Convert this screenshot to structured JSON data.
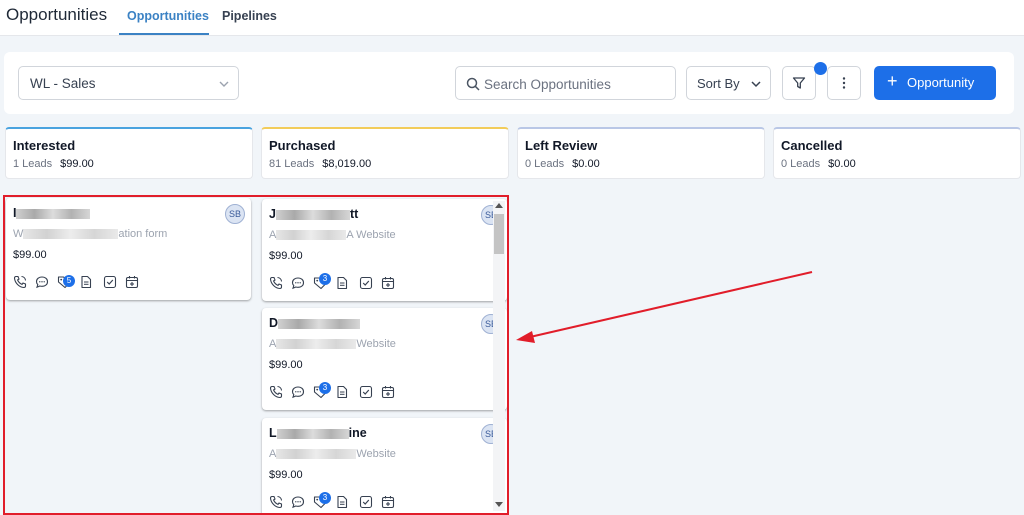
{
  "header": {
    "title": "Opportunities",
    "tabs": [
      {
        "label": "Opportunities",
        "active": true
      },
      {
        "label": "Pipelines",
        "active": false
      }
    ]
  },
  "toolbar": {
    "pipeline_select": "WL - Sales",
    "search_placeholder": "Search Opportunities",
    "sort_label": "Sort By",
    "add_button_label": "Opportunity",
    "add_button_icon": "+"
  },
  "colors": {
    "accent": "#1d6fe8",
    "tab_active": "#3b82c4",
    "interested_border": "#4aa3df",
    "purchased_border": "#f2cc5a",
    "left_review_border": "#b9c7e6",
    "cancelled_border": "#b9c7e6",
    "highlight": "#e11d2a"
  },
  "columns": [
    {
      "name": "Interested",
      "leads": "1 Leads",
      "amount": "$99.00"
    },
    {
      "name": "Purchased",
      "leads": "81 Leads",
      "amount": "$8,019.00"
    },
    {
      "name": "Left Review",
      "leads": "0 Leads",
      "amount": "$0.00"
    },
    {
      "name": "Cancelled",
      "leads": "0 Leads",
      "amount": "$0.00"
    }
  ],
  "cards": [
    {
      "column": "Interested",
      "name_start": "I",
      "name_end": "",
      "source_start": "W",
      "source_end": "ation form",
      "value": "$99.00",
      "avatar": "SB",
      "tag_count": "5"
    },
    {
      "column": "Purchased",
      "name_start": "J",
      "name_end": "tt",
      "source_start": "A",
      "source_end": "A Website",
      "value": "$99.00",
      "avatar": "SB",
      "tag_count": "3"
    },
    {
      "column": "Purchased",
      "name_start": "D",
      "name_end": "",
      "source_start": "A",
      "source_end": "Website",
      "value": "$99.00",
      "avatar": "SB",
      "tag_count": "3"
    },
    {
      "column": "Purchased",
      "name_start": "L",
      "name_end": "ine",
      "source_start": "A",
      "source_end": "Website",
      "value": "$99.00",
      "avatar": "SB",
      "tag_count": "3"
    }
  ],
  "card_icons": [
    "phone-icon",
    "chat-icon",
    "tag-icon",
    "document-icon",
    "checkbox-icon",
    "calendar-icon"
  ]
}
